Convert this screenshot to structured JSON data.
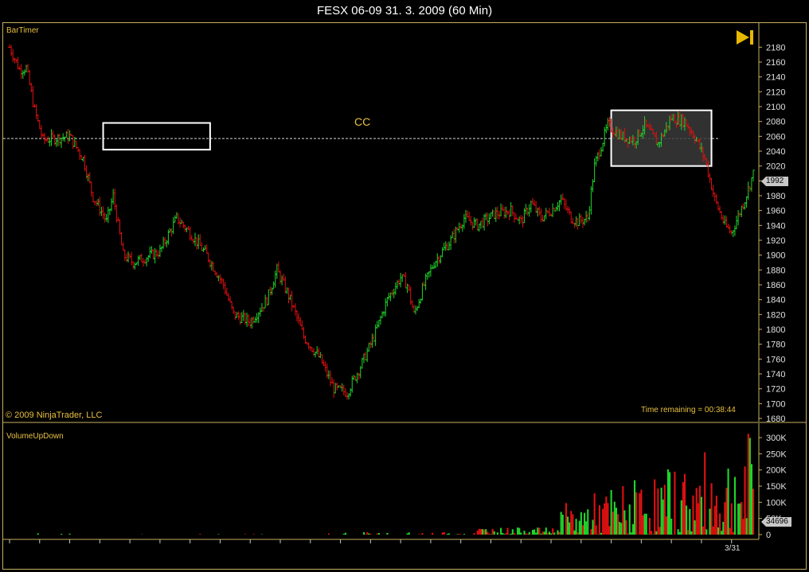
{
  "window": {
    "title": "FESX 06-09  31. 3. 2009 (60 Min)"
  },
  "price_panel": {
    "indicator_label": "BarTimer",
    "copyright": "© 2009 NinjaTrader, LLC",
    "time_remaining": "Time remaining = 00:38:44",
    "annotation": "CC",
    "last_price_tag": "1992",
    "play_icon": "skip-to-end-icon"
  },
  "volume_panel": {
    "indicator_label": "VolumeUpDown",
    "last_volume_tag": "34696"
  },
  "x_axis": {
    "date_label": "3/31"
  },
  "colors": {
    "up": "#1fd62a",
    "down": "#e01010",
    "axis": "#c8b060",
    "text": "#e8c040"
  },
  "chart_data": [
    {
      "type": "ohlc",
      "ylim": [
        1680,
        2190
      ],
      "yticks": [
        "2180",
        "2160",
        "2140",
        "2120",
        "2100",
        "2080",
        "2060",
        "2040",
        "2020",
        "2000",
        "1980",
        "1960",
        "1940",
        "1920",
        "1900",
        "1880",
        "1860",
        "1840",
        "1820",
        "1800",
        "1780",
        "1760",
        "1740",
        "1720",
        "1700",
        "1680"
      ],
      "reference_line": 2057,
      "anchors": [
        [
          0,
          2180
        ],
        [
          6,
          2150
        ],
        [
          10,
          2152
        ],
        [
          15,
          2095
        ],
        [
          20,
          2055
        ],
        [
          36,
          2060
        ],
        [
          44,
          2030
        ],
        [
          50,
          1978
        ],
        [
          56,
          1955
        ],
        [
          58,
          1945
        ],
        [
          62,
          1980
        ],
        [
          68,
          1900
        ],
        [
          74,
          1890
        ],
        [
          90,
          1905
        ],
        [
          100,
          1950
        ],
        [
          108,
          1930
        ],
        [
          118,
          1900
        ],
        [
          128,
          1860
        ],
        [
          134,
          1820
        ],
        [
          144,
          1810
        ],
        [
          154,
          1840
        ],
        [
          160,
          1880
        ],
        [
          168,
          1840
        ],
        [
          176,
          1790
        ],
        [
          186,
          1760
        ],
        [
          194,
          1720
        ],
        [
          202,
          1715
        ],
        [
          210,
          1750
        ],
        [
          218,
          1790
        ],
        [
          226,
          1840
        ],
        [
          234,
          1870
        ],
        [
          238,
          1860
        ],
        [
          242,
          1820
        ],
        [
          248,
          1860
        ],
        [
          254,
          1890
        ],
        [
          264,
          1920
        ],
        [
          272,
          1950
        ],
        [
          280,
          1940
        ],
        [
          290,
          1955
        ],
        [
          300,
          1960
        ],
        [
          306,
          1945
        ],
        [
          312,
          1970
        ],
        [
          318,
          1950
        ],
        [
          324,
          1960
        ],
        [
          330,
          1975
        ],
        [
          336,
          1950
        ],
        [
          340,
          1945
        ],
        [
          346,
          1950
        ],
        [
          350,
          2020
        ],
        [
          358,
          2075
        ],
        [
          366,
          2060
        ],
        [
          374,
          2055
        ],
        [
          380,
          2075
        ],
        [
          388,
          2050
        ],
        [
          396,
          2085
        ],
        [
          404,
          2080
        ],
        [
          410,
          2060
        ],
        [
          416,
          2030
        ],
        [
          422,
          1975
        ],
        [
          428,
          1940
        ],
        [
          432,
          1930
        ],
        [
          440,
          1975
        ],
        [
          445,
          2010
        ]
      ],
      "box_ranges": [
        [
          0,
          0
        ],
        [
          2042,
          2078
        ],
        [
          2020,
          2095
        ]
      ],
      "bar_count": 446
    },
    {
      "type": "bar",
      "ylim": [
        0,
        310000
      ],
      "yticks": [
        "300K",
        "250K",
        "200K",
        "150K",
        "100K",
        "50K",
        "0"
      ],
      "peak_volume": 312000
    }
  ]
}
